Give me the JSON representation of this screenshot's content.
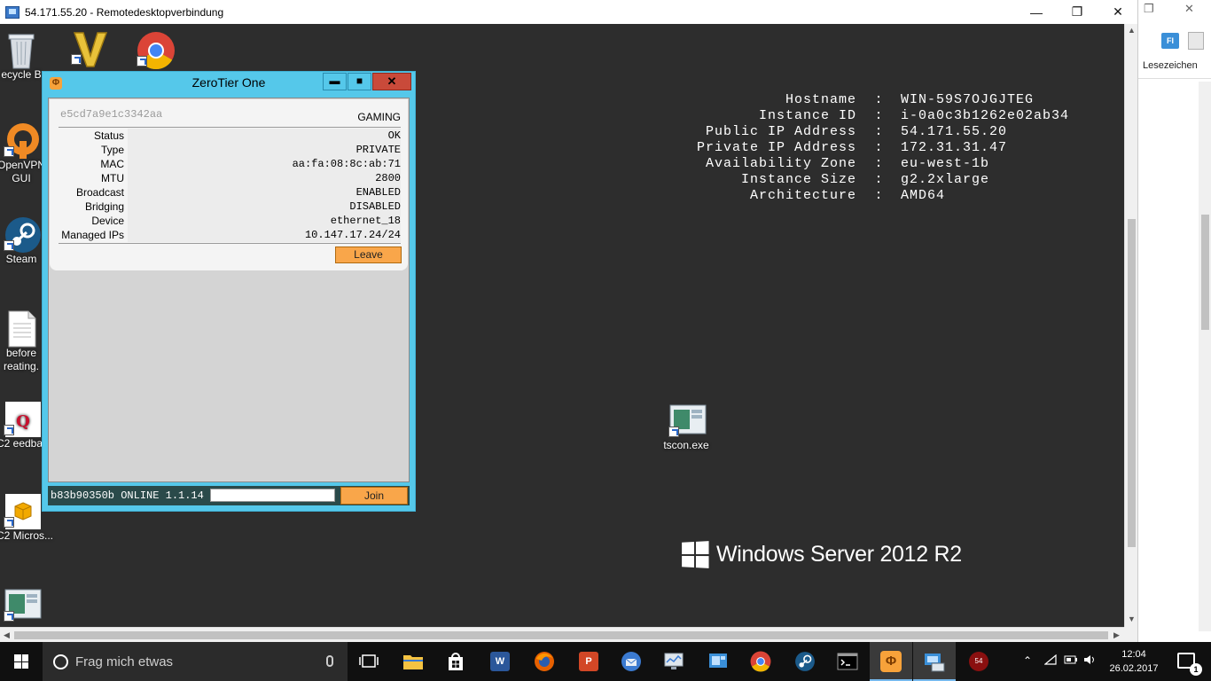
{
  "rdp_window": {
    "title": "54.171.55.20 - Remotedesktopverbindung",
    "minimize": "—",
    "restore": "❐",
    "close": "✕"
  },
  "local_browser": {
    "restore": "❐",
    "close": "✕",
    "bookmark_icon_text": "FI",
    "bookmarks_label": "Lesezeichen"
  },
  "desktop_icons": [
    {
      "label": "ecycle B",
      "icon": "recycle-bin-icon"
    },
    {
      "label": "",
      "icon": "v-app-icon"
    },
    {
      "label": "",
      "icon": "chrome-icon"
    },
    {
      "label": "OpenVPN GUI",
      "icon": "openvpn-icon"
    },
    {
      "label": "Steam",
      "icon": "steam-icon"
    },
    {
      "label": "before reating.",
      "icon": "text-file-icon"
    },
    {
      "label": "EC2 eedback",
      "icon": "ec2-feedback-icon"
    },
    {
      "label": "EC2 Micros...",
      "icon": "ec2-microsoft-icon"
    },
    {
      "label": "",
      "icon": "tscon-shortcut-icon"
    },
    {
      "label": "tscon.exe",
      "icon": "tscon-exe-icon"
    }
  ],
  "server_info": [
    {
      "key": "Hostname",
      "value": "WIN-59S7OJGJTEG"
    },
    {
      "key": "Instance ID",
      "value": "i-0a0c3b1262e02ab34"
    },
    {
      "key": "Public IP Address",
      "value": "54.171.55.20"
    },
    {
      "key": "Private IP Address",
      "value": "172.31.31.47"
    },
    {
      "key": "Availability Zone",
      "value": "eu-west-1b"
    },
    {
      "key": "Instance Size",
      "value": "g2.2xlarge"
    },
    {
      "key": "Architecture",
      "value": "AMD64"
    }
  ],
  "server_info_separator": ":",
  "windows_server_logo": "Windows Server 2012 R2",
  "zerotier": {
    "title": "ZeroTier One",
    "minimize": "▬",
    "maximize": "■",
    "close": "✕",
    "network": {
      "id": "e5cd7a9e1c3342aa",
      "name": "GAMING",
      "properties": [
        {
          "label": "Status",
          "value": "OK"
        },
        {
          "label": "Type",
          "value": "PRIVATE"
        },
        {
          "label": "MAC",
          "value": "aa:fa:08:8c:ab:71"
        },
        {
          "label": "MTU",
          "value": "2800"
        },
        {
          "label": "Broadcast",
          "value": "ENABLED"
        },
        {
          "label": "Bridging",
          "value": "DISABLED"
        },
        {
          "label": "Device",
          "value": "ethernet_18"
        },
        {
          "label": "Managed IPs",
          "value": "10.147.17.24/24"
        }
      ],
      "leave_label": "Leave"
    },
    "status_line": "b83b90350b ONLINE 1.1.14",
    "join_input_value": "",
    "join_label": "Join"
  },
  "taskbar": {
    "search_placeholder": "Frag mich etwas",
    "apps": [
      "task-view",
      "file-explorer",
      "store",
      "word",
      "firefox",
      "powerpoint",
      "thunderbird",
      "monitor",
      "remote-desktop-app",
      "chrome",
      "steam",
      "cmd",
      "zerotier",
      "rdp-connection",
      "app-54"
    ],
    "app_54_badge": "54",
    "time": "12:04",
    "date": "26.02.2017",
    "notification_count": "1"
  },
  "colors": {
    "zerotier_accent": "#55c8ea",
    "zerotier_button": "#f9a64a",
    "desktop_bg": "#2d2d2d",
    "taskbar_bg": "#101010"
  }
}
